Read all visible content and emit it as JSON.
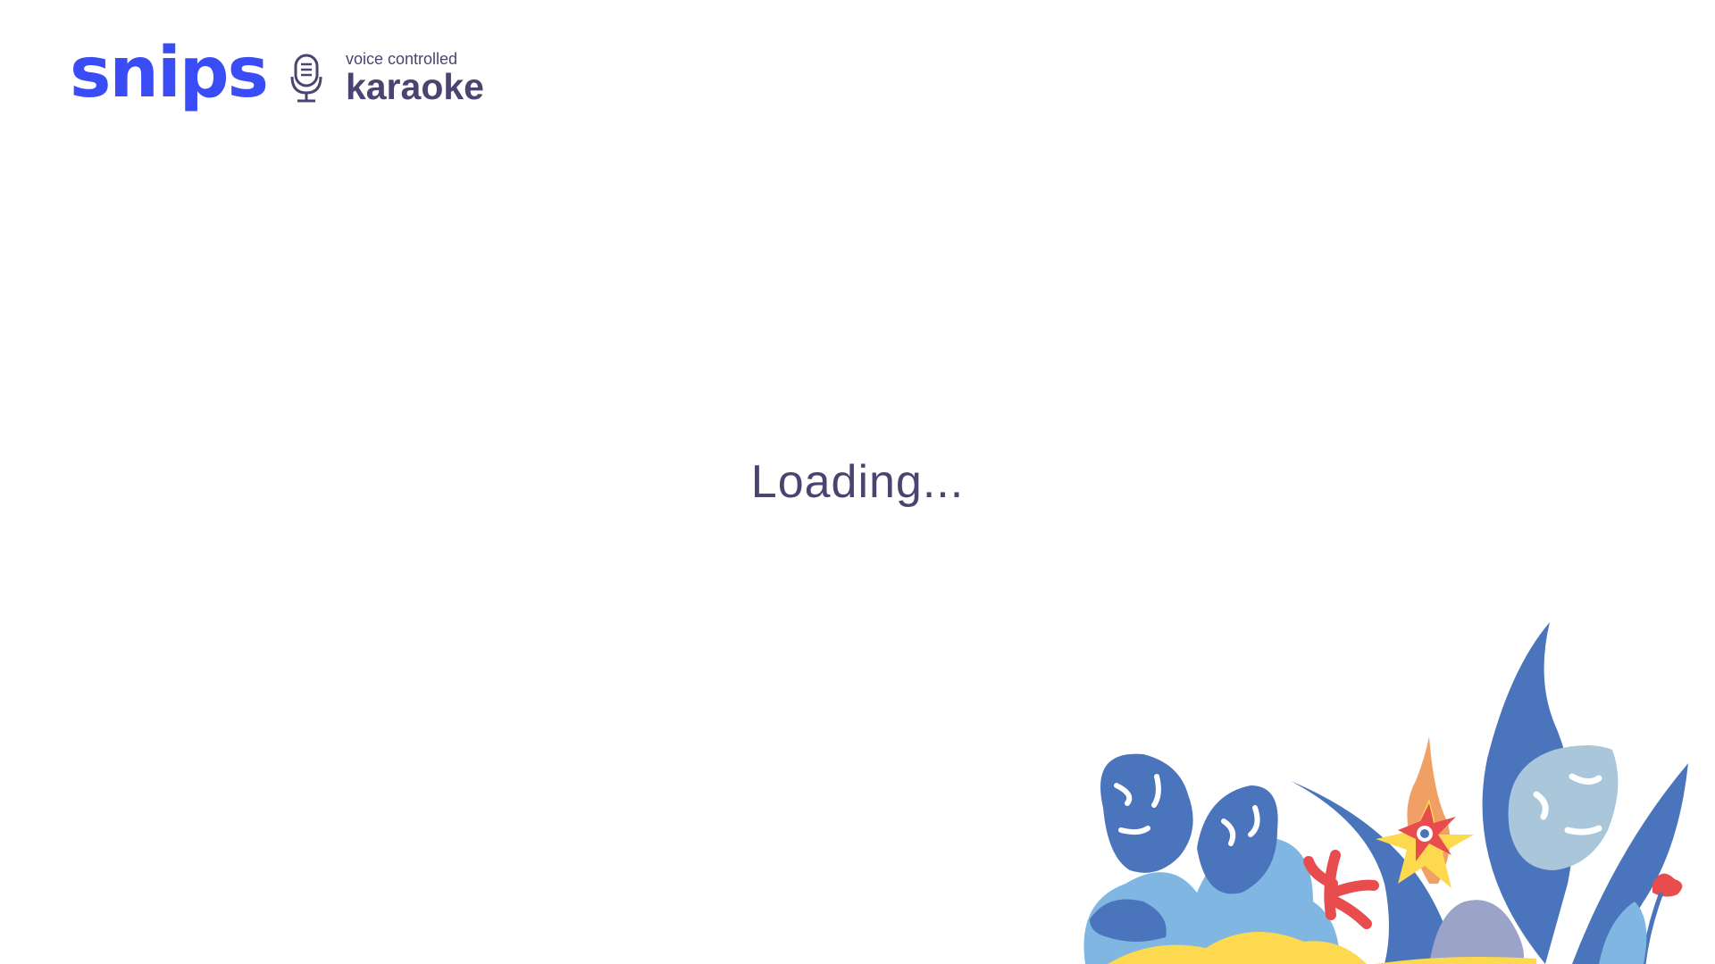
{
  "header": {
    "brand": "snips",
    "subtitle": "voice controlled",
    "title": "karaoke",
    "icon": "microphone-icon"
  },
  "status": {
    "text": "Loading..."
  },
  "colors": {
    "brand": "#3a4cf5",
    "text": "#4a4570",
    "leaf_dark": "#4a74bb",
    "leaf_light": "#7fb7e2",
    "leaf_pale": "#a9c6da",
    "flower_red": "#e84c4c",
    "flower_yellow": "#fcd94e",
    "flame_orange": "#f0a064",
    "rock_grey": "#9ba3c8"
  },
  "illustration": {
    "name": "tropical-plants-illustration"
  }
}
